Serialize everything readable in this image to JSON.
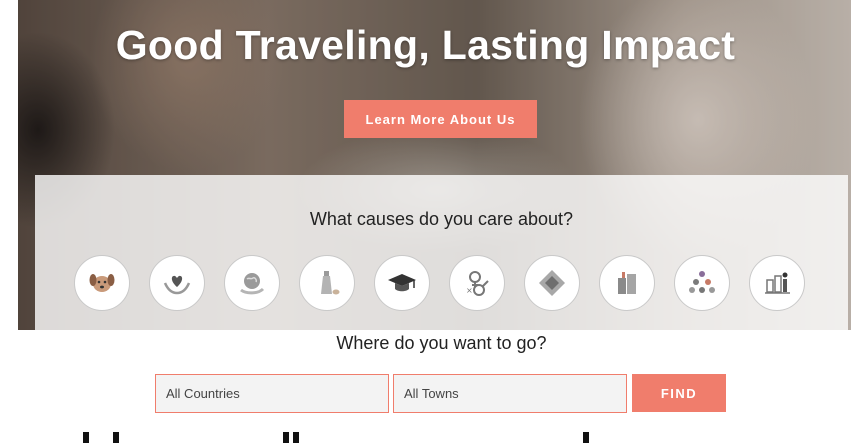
{
  "hero": {
    "title": "Good Traveling, Lasting Impact",
    "button_label": "Learn More About Us"
  },
  "causes": {
    "title": "What causes do you care about?",
    "icons": [
      "dog-icon",
      "heart-in-hands-icon",
      "earth-hand-icon",
      "bottle-icon",
      "graduation-cap-icon",
      "gender-icon",
      "diamond-icon",
      "buildings-icon",
      "people-group-icon",
      "community-icon"
    ]
  },
  "search": {
    "title": "Where do you want to go?",
    "country_value": "All Countries",
    "town_value": "All Towns",
    "find_label": "FIND"
  },
  "colors": {
    "accent": "#f07d6c",
    "icon_gray": "#8a8a8a"
  }
}
